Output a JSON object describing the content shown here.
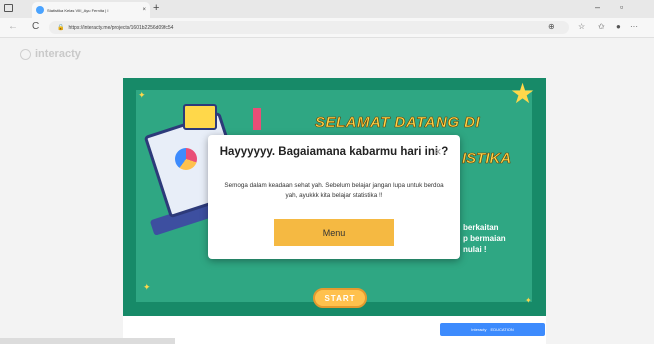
{
  "browser": {
    "tab_title": "Statistika Kelas VIII_Ayu Fernita | I",
    "tab_close": "×",
    "new_tab": "+",
    "url": "https://interacty.me/projects/1601b2256d09fc54",
    "back": "←",
    "reload": "C",
    "minimize": "–",
    "restore": "▫",
    "more": "···"
  },
  "page": {
    "logo_text": "interacty",
    "banner_line1": "SELAMAT DATANG DI",
    "banner_line2": "ISTIKA",
    "right_text_line1": "berkaitan",
    "right_text_line2": "p bermaian",
    "right_text_line3": "nulai !",
    "start_label": "START",
    "badge_label": "Interacty",
    "badge_label2": "EDUCATION"
  },
  "modal": {
    "title": "Hayyyyyy. Bagaiamana kabarmu hari ini ?",
    "close_label": "×",
    "body": "Semoga dalam keadaan sehat yah. Sebelum belajar jangan lupa untuk berdoa yah, ayukkk kita belajar statistika !!",
    "menu_button": "Menu"
  },
  "colors": {
    "stage_green": "#178a68",
    "accent_yellow": "#f5b942"
  }
}
